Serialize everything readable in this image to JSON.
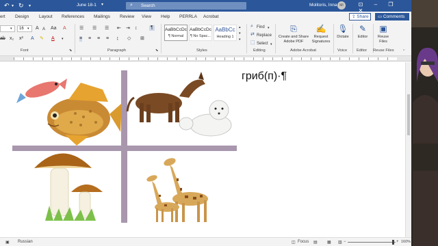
{
  "titlebar": {
    "document_title": "June 18-1",
    "search_placeholder": "Search",
    "user_name": "Molitoris, Inna",
    "user_initials": "MI"
  },
  "tabs": [
    "ert",
    "Design",
    "Layout",
    "References",
    "Mailings",
    "Review",
    "View",
    "Help",
    "PERRLA",
    "Acrobat"
  ],
  "share_label": "Share",
  "comments_label": "Comments",
  "font": {
    "size": "16"
  },
  "styles": [
    {
      "preview": "AaBbCcDc",
      "name": "¶ Normal"
    },
    {
      "preview": "AaBbCcDc",
      "name": "¶ No Spac..."
    },
    {
      "preview": "AaBbCc",
      "name": "Heading 1"
    }
  ],
  "editing": {
    "find": "Find",
    "replace": "Replace",
    "select": "Select"
  },
  "acrobat": {
    "create_share": "Create and Share Adobe PDF",
    "request_signatures": "Request Signatures"
  },
  "dictate_label": "Dictate",
  "editor_label": "Editor",
  "reuse_files_label": "Reuse Files",
  "group_labels": {
    "font": "Font",
    "paragraph": "Paragraph",
    "styles": "Styles",
    "editing": "Editing",
    "adobe_acrobat": "Adobe Acrobat",
    "voice": "Voice",
    "editor": "Editor",
    "reuse_files": "Reuse Files"
  },
  "document": {
    "text": "гриб(п)·¶"
  },
  "status": {
    "language": "Russian",
    "focus": "Focus",
    "zoom": "160%"
  }
}
